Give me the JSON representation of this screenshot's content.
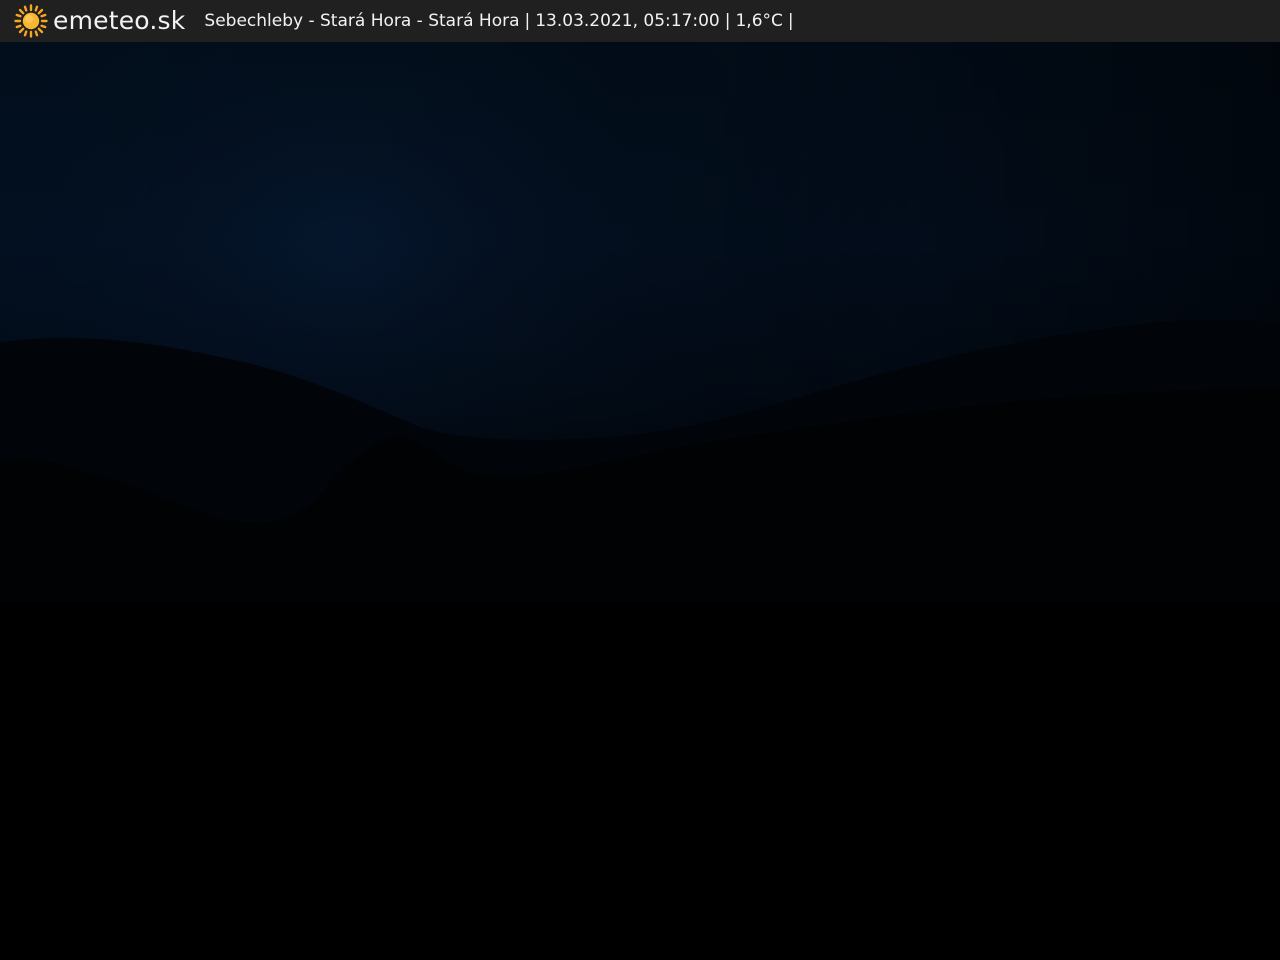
{
  "header": {
    "brand": "emeteo.sk",
    "logo_icon": "sun-icon",
    "logo_color": "#f5a623",
    "location": "Sebechleby - Stará Hora - Stará Hora",
    "datetime": "13.03.2021, 05:17:00",
    "temperature": "1,6°C",
    "separator": "|"
  },
  "scene": {
    "description_colors": {
      "sky_top": "#031226",
      "ground": "#000000"
    }
  }
}
